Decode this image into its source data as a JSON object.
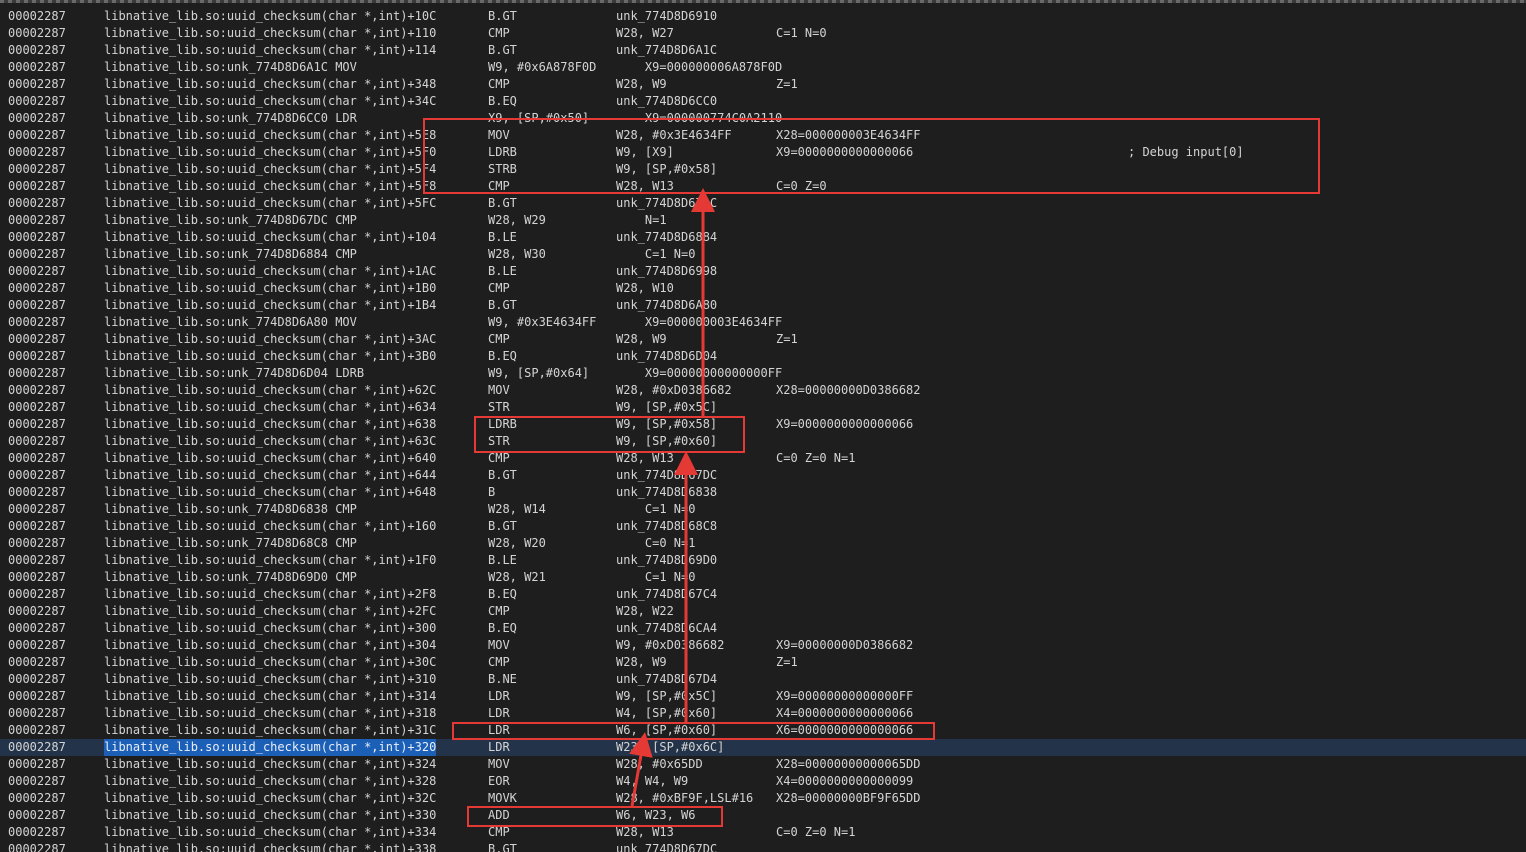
{
  "trace": {
    "rows": [
      {
        "thread": "00002287",
        "addr": "libnative_lib.so:uuid_checksum(char *,int)+10C",
        "mnem": "B.GT",
        "ops": "unk_774D8D6910",
        "regs": "",
        "comment": ""
      },
      {
        "thread": "00002287",
        "addr": "libnative_lib.so:uuid_checksum(char *,int)+110",
        "mnem": "CMP",
        "ops": "W28, W27",
        "regs": "C=1 N=0",
        "comment": ""
      },
      {
        "thread": "00002287",
        "addr": "libnative_lib.so:uuid_checksum(char *,int)+114",
        "mnem": "B.GT",
        "ops": "unk_774D8D6A1C",
        "regs": "",
        "comment": ""
      },
      {
        "thread": "00002287",
        "addr": "libnative_lib.so:unk_774D8D6A1C MOV",
        "mnem": "W9, #0x6A878F0D",
        "ops": "    X9=000000006A878F0D",
        "regs": "",
        "comment": ""
      },
      {
        "thread": "00002287",
        "addr": "libnative_lib.so:uuid_checksum(char *,int)+348",
        "mnem": "CMP",
        "ops": "W28, W9",
        "regs": "Z=1",
        "comment": ""
      },
      {
        "thread": "00002287",
        "addr": "libnative_lib.so:uuid_checksum(char *,int)+34C",
        "mnem": "B.EQ",
        "ops": "unk_774D8D6CC0",
        "regs": "",
        "comment": ""
      },
      {
        "thread": "00002287",
        "addr": "libnative_lib.so:unk_774D8D6CC0 LDR",
        "mnem": "X9, [SP,#0x50]",
        "ops": "    X9=000000774C0A2110",
        "regs": "",
        "comment": ""
      },
      {
        "thread": "00002287",
        "addr": "libnative_lib.so:uuid_checksum(char *,int)+5E8",
        "mnem": "MOV",
        "ops": "W28, #0x3E4634FF",
        "regs": "X28=000000003E4634FF",
        "comment": ""
      },
      {
        "thread": "00002287",
        "addr": "libnative_lib.so:uuid_checksum(char *,int)+5F0",
        "mnem": "LDRB",
        "ops": "W9, [X9]",
        "regs": "X9=0000000000000066",
        "comment": "; Debug input[0]"
      },
      {
        "thread": "00002287",
        "addr": "libnative_lib.so:uuid_checksum(char *,int)+5F4",
        "mnem": "STRB",
        "ops": "W9, [SP,#0x58]",
        "regs": "",
        "comment": ""
      },
      {
        "thread": "00002287",
        "addr": "libnative_lib.so:uuid_checksum(char *,int)+5F8",
        "mnem": "CMP",
        "ops": "W28, W13",
        "regs": "C=0 Z=0",
        "comment": ""
      },
      {
        "thread": "00002287",
        "addr": "libnative_lib.so:uuid_checksum(char *,int)+5FC",
        "mnem": "B.GT",
        "ops": "unk_774D8D67DC",
        "regs": "",
        "comment": ""
      },
      {
        "thread": "00002287",
        "addr": "libnative_lib.so:unk_774D8D67DC CMP",
        "mnem": "W28, W29",
        "ops": "    N=1",
        "regs": "",
        "comment": ""
      },
      {
        "thread": "00002287",
        "addr": "libnative_lib.so:uuid_checksum(char *,int)+104",
        "mnem": "B.LE",
        "ops": "unk_774D8D6884",
        "regs": "",
        "comment": ""
      },
      {
        "thread": "00002287",
        "addr": "libnative_lib.so:unk_774D8D6884 CMP",
        "mnem": "W28, W30",
        "ops": "    C=1 N=0",
        "regs": "",
        "comment": ""
      },
      {
        "thread": "00002287",
        "addr": "libnative_lib.so:uuid_checksum(char *,int)+1AC",
        "mnem": "B.LE",
        "ops": "unk_774D8D6998",
        "regs": "",
        "comment": ""
      },
      {
        "thread": "00002287",
        "addr": "libnative_lib.so:uuid_checksum(char *,int)+1B0",
        "mnem": "CMP",
        "ops": "W28, W10",
        "regs": "",
        "comment": ""
      },
      {
        "thread": "00002287",
        "addr": "libnative_lib.so:uuid_checksum(char *,int)+1B4",
        "mnem": "B.GT",
        "ops": "unk_774D8D6A80",
        "regs": "",
        "comment": ""
      },
      {
        "thread": "00002287",
        "addr": "libnative_lib.so:unk_774D8D6A80 MOV",
        "mnem": "W9, #0x3E4634FF",
        "ops": "    X9=000000003E4634FF",
        "regs": "",
        "comment": ""
      },
      {
        "thread": "00002287",
        "addr": "libnative_lib.so:uuid_checksum(char *,int)+3AC",
        "mnem": "CMP",
        "ops": "W28, W9",
        "regs": "Z=1",
        "comment": ""
      },
      {
        "thread": "00002287",
        "addr": "libnative_lib.so:uuid_checksum(char *,int)+3B0",
        "mnem": "B.EQ",
        "ops": "unk_774D8D6D04",
        "regs": "",
        "comment": ""
      },
      {
        "thread": "00002287",
        "addr": "libnative_lib.so:unk_774D8D6D04 LDRB",
        "mnem": "W9, [SP,#0x64]",
        "ops": "    X9=00000000000000FF",
        "regs": "",
        "comment": ""
      },
      {
        "thread": "00002287",
        "addr": "libnative_lib.so:uuid_checksum(char *,int)+62C",
        "mnem": "MOV",
        "ops": "W28, #0xD0386682",
        "regs": "X28=00000000D0386682",
        "comment": ""
      },
      {
        "thread": "00002287",
        "addr": "libnative_lib.so:uuid_checksum(char *,int)+634",
        "mnem": "STR",
        "ops": "W9, [SP,#0x5C]",
        "regs": "",
        "comment": ""
      },
      {
        "thread": "00002287",
        "addr": "libnative_lib.so:uuid_checksum(char *,int)+638",
        "mnem": "LDRB",
        "ops": "W9, [SP,#0x58]",
        "regs": "X9=0000000000000066",
        "comment": ""
      },
      {
        "thread": "00002287",
        "addr": "libnative_lib.so:uuid_checksum(char *,int)+63C",
        "mnem": "STR",
        "ops": "W9, [SP,#0x60]",
        "regs": "",
        "comment": ""
      },
      {
        "thread": "00002287",
        "addr": "libnative_lib.so:uuid_checksum(char *,int)+640",
        "mnem": "CMP",
        "ops": "W28, W13",
        "regs": "C=0 Z=0 N=1",
        "comment": ""
      },
      {
        "thread": "00002287",
        "addr": "libnative_lib.so:uuid_checksum(char *,int)+644",
        "mnem": "B.GT",
        "ops": "unk_774D8D67DC",
        "regs": "",
        "comment": ""
      },
      {
        "thread": "00002287",
        "addr": "libnative_lib.so:uuid_checksum(char *,int)+648",
        "mnem": "B",
        "ops": "unk_774D8D6838",
        "regs": "",
        "comment": ""
      },
      {
        "thread": "00002287",
        "addr": "libnative_lib.so:unk_774D8D6838 CMP",
        "mnem": "W28, W14",
        "ops": "    C=1 N=0",
        "regs": "",
        "comment": ""
      },
      {
        "thread": "00002287",
        "addr": "libnative_lib.so:uuid_checksum(char *,int)+160",
        "mnem": "B.GT",
        "ops": "unk_774D8D68C8",
        "regs": "",
        "comment": ""
      },
      {
        "thread": "00002287",
        "addr": "libnative_lib.so:unk_774D8D68C8 CMP",
        "mnem": "W28, W20",
        "ops": "    C=0 N=1",
        "regs": "",
        "comment": ""
      },
      {
        "thread": "00002287",
        "addr": "libnative_lib.so:uuid_checksum(char *,int)+1F0",
        "mnem": "B.LE",
        "ops": "unk_774D8D69D0",
        "regs": "",
        "comment": ""
      },
      {
        "thread": "00002287",
        "addr": "libnative_lib.so:unk_774D8D69D0 CMP",
        "mnem": "W28, W21",
        "ops": "    C=1 N=0",
        "regs": "",
        "comment": ""
      },
      {
        "thread": "00002287",
        "addr": "libnative_lib.so:uuid_checksum(char *,int)+2F8",
        "mnem": "B.EQ",
        "ops": "unk_774D8D67C4",
        "regs": "",
        "comment": ""
      },
      {
        "thread": "00002287",
        "addr": "libnative_lib.so:uuid_checksum(char *,int)+2FC",
        "mnem": "CMP",
        "ops": "W28, W22",
        "regs": "",
        "comment": ""
      },
      {
        "thread": "00002287",
        "addr": "libnative_lib.so:uuid_checksum(char *,int)+300",
        "mnem": "B.EQ",
        "ops": "unk_774D8D6CA4",
        "regs": "",
        "comment": ""
      },
      {
        "thread": "00002287",
        "addr": "libnative_lib.so:uuid_checksum(char *,int)+304",
        "mnem": "MOV",
        "ops": "W9, #0xD0386682",
        "regs": "X9=00000000D0386682",
        "comment": ""
      },
      {
        "thread": "00002287",
        "addr": "libnative_lib.so:uuid_checksum(char *,int)+30C",
        "mnem": "CMP",
        "ops": "W28, W9",
        "regs": "Z=1",
        "comment": ""
      },
      {
        "thread": "00002287",
        "addr": "libnative_lib.so:uuid_checksum(char *,int)+310",
        "mnem": "B.NE",
        "ops": "unk_774D8D67D4",
        "regs": "",
        "comment": ""
      },
      {
        "thread": "00002287",
        "addr": "libnative_lib.so:uuid_checksum(char *,int)+314",
        "mnem": "LDR",
        "ops": "W9, [SP,#0x5C]",
        "regs": "X9=00000000000000FF",
        "comment": ""
      },
      {
        "thread": "00002287",
        "addr": "libnative_lib.so:uuid_checksum(char *,int)+318",
        "mnem": "LDR",
        "ops": "W4, [SP,#0x60]",
        "regs": "X4=0000000000000066",
        "comment": ""
      },
      {
        "thread": "00002287",
        "addr": "libnative_lib.so:uuid_checksum(char *,int)+31C",
        "mnem": "LDR",
        "ops": "W6, [SP,#0x60]",
        "regs": "X6=0000000000000066",
        "comment": ""
      },
      {
        "thread": "00002287",
        "addr": "libnative_lib.so:uuid_checksum(char *,int)+320",
        "mnem": "LDR",
        "ops": "W23, [SP,#0x6C]",
        "regs": "",
        "comment": "",
        "current": true
      },
      {
        "thread": "00002287",
        "addr": "libnative_lib.so:uuid_checksum(char *,int)+324",
        "mnem": "MOV",
        "ops": "W28, #0x65DD",
        "regs": "X28=00000000000065DD",
        "comment": ""
      },
      {
        "thread": "00002287",
        "addr": "libnative_lib.so:uuid_checksum(char *,int)+328",
        "mnem": "EOR",
        "ops": "W4, W4, W9",
        "regs": "X4=0000000000000099",
        "comment": ""
      },
      {
        "thread": "00002287",
        "addr": "libnative_lib.so:uuid_checksum(char *,int)+32C",
        "mnem": "MOVK",
        "ops": "W28, #0xBF9F,LSL#16",
        "regs": "X28=00000000BF9F65DD",
        "comment": ""
      },
      {
        "thread": "00002287",
        "addr": "libnative_lib.so:uuid_checksum(char *,int)+330",
        "mnem": "ADD",
        "ops": "W6, W23, W6",
        "regs": "",
        "comment": ""
      },
      {
        "thread": "00002287",
        "addr": "libnative_lib.so:uuid_checksum(char *,int)+334",
        "mnem": "CMP",
        "ops": "W28, W13",
        "regs": "C=0 Z=0 N=1",
        "comment": ""
      },
      {
        "thread": "00002287",
        "addr": "libnative_lib.so:uuid_checksum(char *,int)+338",
        "mnem": "B.GT",
        "ops": "unk_774D8D67DC",
        "regs": "",
        "comment": ""
      }
    ]
  },
  "colors": {
    "background": "#1e1e1e",
    "text": "#d4d4d4",
    "current_row": "#23334a",
    "selection": "#1c5fb6",
    "annotation": "#e53935"
  }
}
